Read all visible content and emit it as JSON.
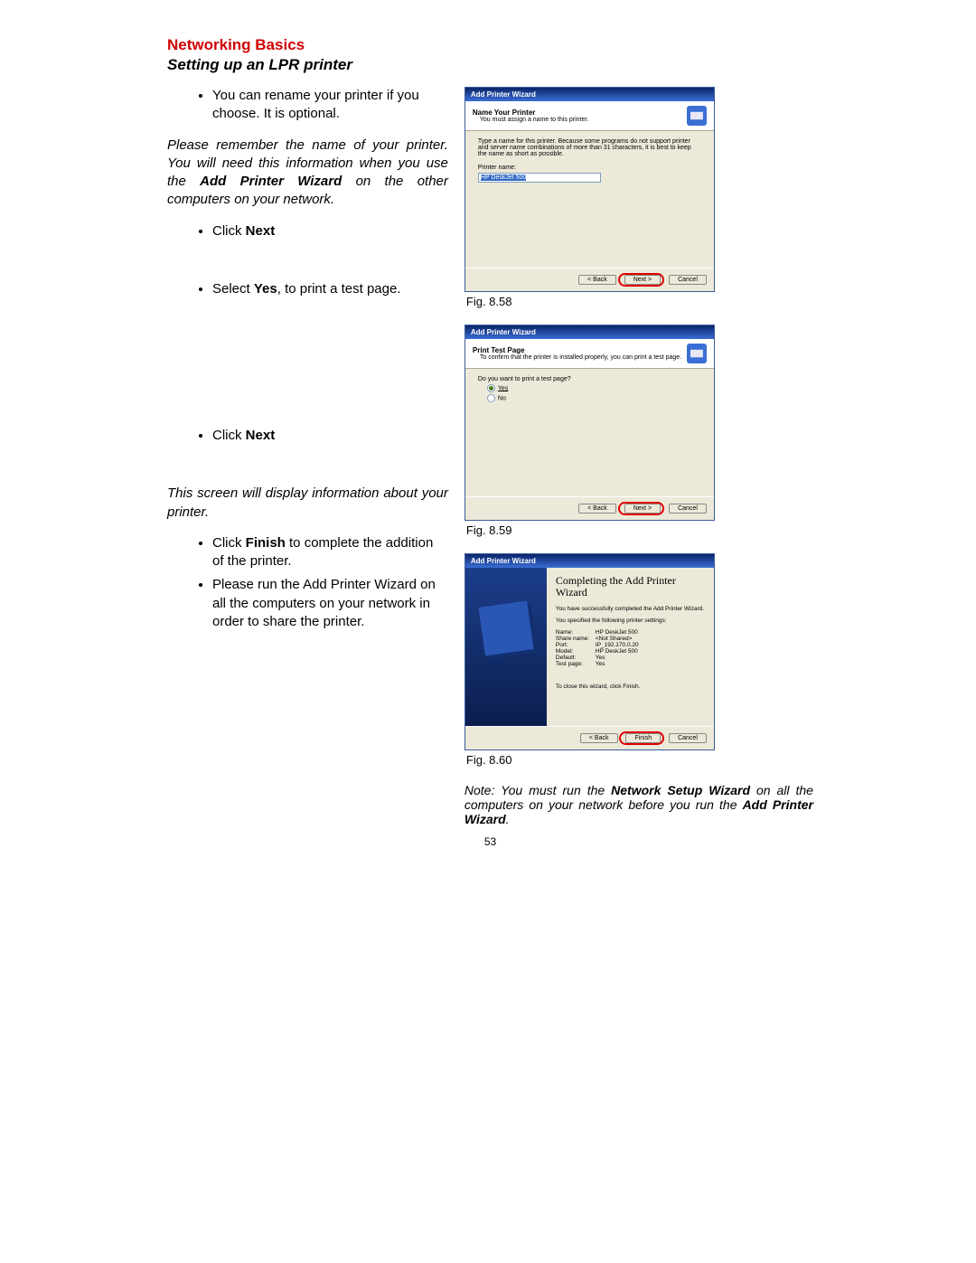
{
  "title": "Networking Basics",
  "subtitle": "Setting up an LPR printer",
  "left": {
    "bul1": "You can rename your printer if you choose.  It is optional.",
    "note1a": "Please remember the name of your printer.  You will need this information when you use the ",
    "note1b": "Add Printer Wizard",
    "note1c": " on the other computers on your network.",
    "bul2a": "Click ",
    "bul2b": "Next",
    "bul3a": "Select ",
    "bul3b": "Yes",
    "bul3c": ", to print a test page.",
    "bul4a": "Click ",
    "bul4b": "Next",
    "note2": "This screen will display information about your printer.",
    "bul5a": "Click ",
    "bul5b": "Finish",
    "bul5c": " to complete the addition of the printer.",
    "bul6": "Please run the Add Printer Wizard on all the computers on your network in order to share the printer."
  },
  "figcap1": "Fig. 8.58",
  "figcap2": "Fig. 8.59",
  "figcap3": "Fig. 8.60",
  "footnote_a": "Note:  You must run the ",
  "footnote_b": "Network Setup Wizard",
  "footnote_c": " on all the computers on your network before you run the ",
  "footnote_d": "Add Printer Wizard",
  "footnote_e": ".",
  "pagenum": "53",
  "wiz1": {
    "title": "Add Printer Wizard",
    "head_title": "Name Your Printer",
    "head_sub": "You must assign a name to this printer.",
    "body_txt": "Type a name for this printer. Because some programs do not support printer and server name combinations of more than 31 characters, it is best to keep the name as short as possible.",
    "field_lbl": "Printer name:",
    "field_val": "HP DeskJet 500",
    "btn_back": "< Back",
    "btn_next": "Next >",
    "btn_cancel": "Cancel"
  },
  "wiz2": {
    "title": "Add Printer Wizard",
    "head_title": "Print Test Page",
    "head_sub": "To confirm that the printer is installed properly, you can print a test page.",
    "q": "Do you want to print a test page?",
    "opt_yes": "Yes",
    "opt_no": "No",
    "btn_back": "< Back",
    "btn_next": "Next >",
    "btn_cancel": "Cancel"
  },
  "wiz3": {
    "title": "Add Printer Wizard",
    "caption": "Completing the Add Printer Wizard",
    "line1": "You have successfully completed the Add Printer Wizard.",
    "line2": "You specified the following printer settings:",
    "spec": {
      "Name": "HP DeskJet 500",
      "Share name": "<Not Shared>",
      "Port": "IP_192.170.0.20",
      "Model": "HP DeskJet 500",
      "Default": "Yes",
      "Test page": "Yes"
    },
    "close_txt": "To close this wizard, click Finish.",
    "btn_back": "< Back",
    "btn_finish": "Finish",
    "btn_cancel": "Cancel"
  }
}
